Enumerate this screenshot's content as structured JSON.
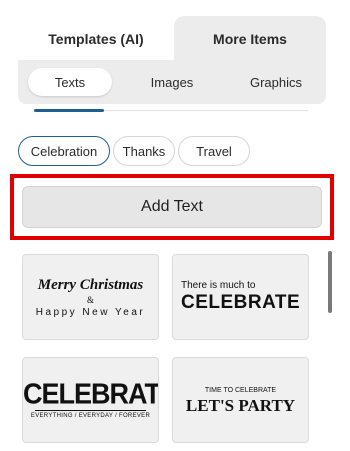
{
  "top_tabs": [
    {
      "label": "Templates (AI)"
    },
    {
      "label": "More Items"
    }
  ],
  "sub_tabs": [
    {
      "label": "Texts",
      "selected": true
    },
    {
      "label": "Images"
    },
    {
      "label": "Graphics"
    }
  ],
  "filters": [
    {
      "label": "Celebration",
      "selected": true
    },
    {
      "label": "Thanks"
    },
    {
      "label": "Travel"
    }
  ],
  "add_text": {
    "label": "Add Text"
  },
  "templates": [
    {
      "line1": "Merry Christmas",
      "line2": "&",
      "line3": "Happy New Year"
    },
    {
      "line1": "There is much to",
      "line2": "CELEBRATE"
    },
    {
      "line1": "CELEBRATE",
      "line2": "EVERYTHING / EVERYDAY / FOREVER"
    },
    {
      "line1": "TIME TO CELEBRATE",
      "line2": "LET'S PARTY"
    }
  ],
  "colors": {
    "accent": "#1f5f8f",
    "highlight_border": "#e10000",
    "tab_bg": "#ececec"
  }
}
